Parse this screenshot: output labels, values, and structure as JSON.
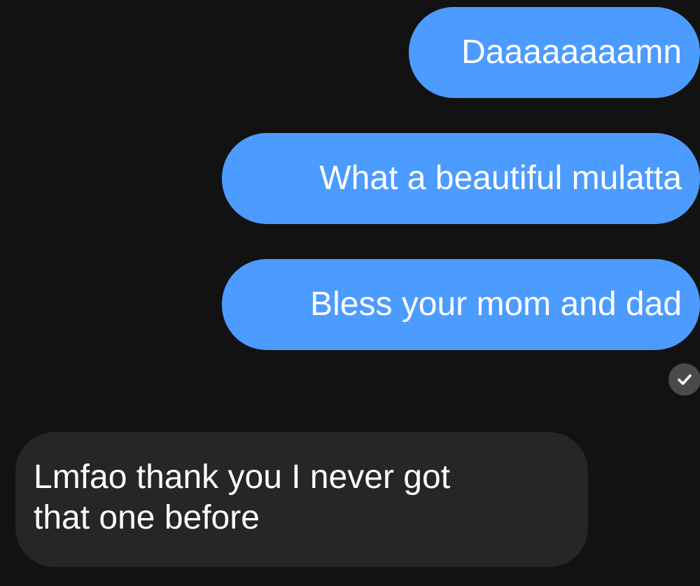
{
  "conversation": {
    "sent_messages": [
      {
        "text": "Daaaaaaaamn"
      },
      {
        "text": "What a beautiful mulatta"
      },
      {
        "text": "Bless your mom and dad"
      }
    ],
    "read_receipt_icon": "check-icon",
    "received_messages": [
      {
        "lines": [
          "Lmfao thank you I never got",
          "that one before"
        ]
      }
    ]
  },
  "colors": {
    "background": "#121212",
    "sent_bubble": "#4c9bff",
    "received_bubble": "#262626",
    "text": "#ffffff",
    "receipt_badge": "#4a4a4a"
  }
}
